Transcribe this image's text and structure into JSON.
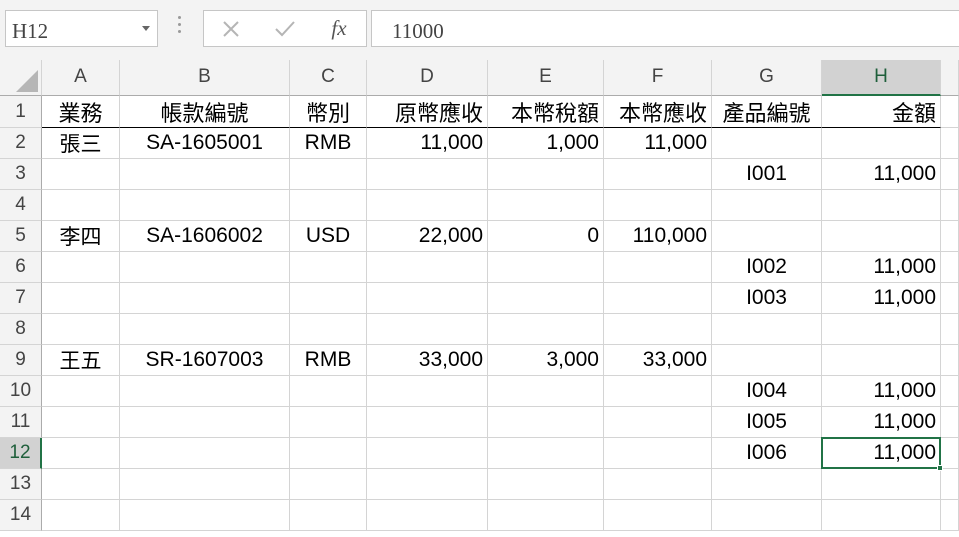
{
  "formula_bar": {
    "name_box": "H12",
    "cancel_icon": "close-icon",
    "enter_icon": "check-icon",
    "fx_label": "fx",
    "formula": "11000"
  },
  "columns": [
    "A",
    "B",
    "C",
    "D",
    "E",
    "F",
    "G",
    "H"
  ],
  "row_numbers": [
    "1",
    "2",
    "3",
    "4",
    "5",
    "6",
    "7",
    "8",
    "9",
    "10",
    "11",
    "12",
    "13",
    "14"
  ],
  "selected_cell": "H12",
  "colors": {
    "accent": "#217346",
    "header_bg": "#f3f3f3",
    "selected_header_bg": "#d2d2d2",
    "gridline": "#d4d4d4"
  },
  "rows": [
    [
      "業務",
      "帳款編號",
      "幣別",
      "原幣應收",
      "本幣稅額",
      "本幣應收",
      "產品編號",
      "金額"
    ],
    [
      "張三",
      "SA-1605001",
      "RMB",
      "11,000",
      "1,000",
      "11,000",
      "",
      ""
    ],
    [
      "",
      "",
      "",
      "",
      "",
      "",
      "I001",
      "11,000"
    ],
    [
      "",
      "",
      "",
      "",
      "",
      "",
      "",
      ""
    ],
    [
      "李四",
      "SA-1606002",
      "USD",
      "22,000",
      "0",
      "110,000",
      "",
      ""
    ],
    [
      "",
      "",
      "",
      "",
      "",
      "",
      "I002",
      "11,000"
    ],
    [
      "",
      "",
      "",
      "",
      "",
      "",
      "I003",
      "11,000"
    ],
    [
      "",
      "",
      "",
      "",
      "",
      "",
      "",
      ""
    ],
    [
      "王五",
      "SR-1607003",
      "RMB",
      "33,000",
      "3,000",
      "33,000",
      "",
      ""
    ],
    [
      "",
      "",
      "",
      "",
      "",
      "",
      "I004",
      "11,000"
    ],
    [
      "",
      "",
      "",
      "",
      "",
      "",
      "I005",
      "11,000"
    ],
    [
      "",
      "",
      "",
      "",
      "",
      "",
      "I006",
      "11,000"
    ],
    [
      "",
      "",
      "",
      "",
      "",
      "",
      "",
      ""
    ],
    [
      "",
      "",
      "",
      "",
      "",
      "",
      "",
      ""
    ]
  ]
}
